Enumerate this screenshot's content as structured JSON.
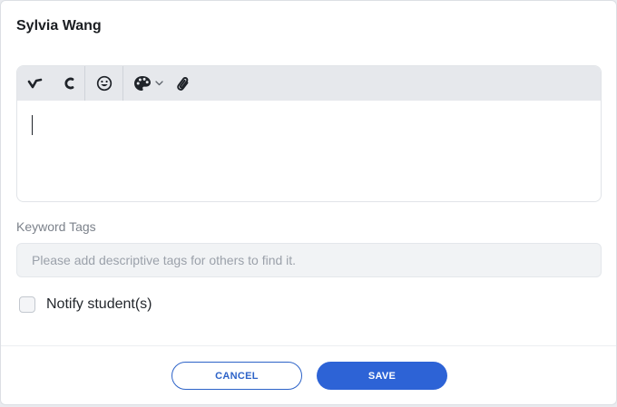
{
  "dialog": {
    "title": "Sylvia Wang"
  },
  "editor": {
    "toolbar": [
      {
        "name": "undo-icon"
      },
      {
        "name": "redo-icon"
      },
      {
        "name": "emoji-icon"
      },
      {
        "name": "palette-icon"
      },
      {
        "name": "attachment-icon"
      }
    ],
    "content": ""
  },
  "keyword_tags": {
    "label": "Keyword Tags",
    "placeholder": "Please add descriptive tags for others to find it.",
    "value": ""
  },
  "notify": {
    "label": "Notify student(s)",
    "checked": false
  },
  "actions": {
    "cancel_label": "CANCEL",
    "save_label": "SAVE"
  },
  "colors": {
    "primary": "#2d63d6",
    "toolbar_bg": "#e6e8ec",
    "input_bg": "#f1f3f5"
  }
}
